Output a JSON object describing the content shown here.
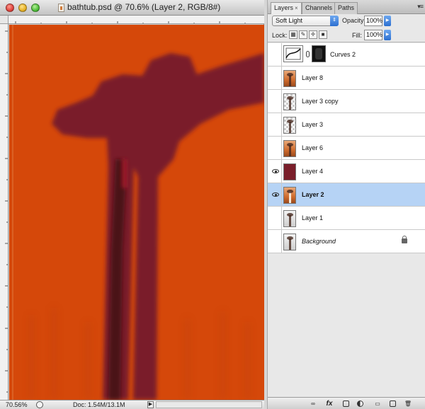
{
  "document": {
    "title": "bathtub.psd @ 70.6% (Layer 2, RGB/8#)",
    "zoom": "70.56%",
    "doc_size": "Doc: 1.54M/13.1M",
    "canvas_color": "#d5480a",
    "figure_color": "#7a1f2c"
  },
  "panel": {
    "tabs": [
      {
        "label": "Layers",
        "active": true,
        "closable": true
      },
      {
        "label": "Channels",
        "active": false
      },
      {
        "label": "Paths",
        "active": false
      }
    ],
    "close_glyph": "×",
    "blend_mode": "Soft Light",
    "opacity_label": "Opacity:",
    "opacity_value": "100%",
    "lock_label": "Lock:",
    "fill_label": "Fill:",
    "fill_value": "100%",
    "layers": [
      {
        "name": "Curves 2",
        "visible": false,
        "selected": false,
        "type": "adjustment"
      },
      {
        "name": "Layer 8",
        "visible": false,
        "selected": false,
        "thumb": "orange"
      },
      {
        "name": "Layer 3 copy",
        "visible": false,
        "selected": false,
        "thumb": "checker"
      },
      {
        "name": "Layer 3",
        "visible": false,
        "selected": false,
        "thumb": "checker"
      },
      {
        "name": "Layer 6",
        "visible": false,
        "selected": false,
        "thumb": "orange"
      },
      {
        "name": "Layer 4",
        "visible": true,
        "selected": false,
        "thumb": "maroon"
      },
      {
        "name": "Layer 2",
        "visible": true,
        "selected": true,
        "thumb": "orange"
      },
      {
        "name": "Layer 1",
        "visible": false,
        "selected": false,
        "thumb": "gray"
      },
      {
        "name": "Background",
        "visible": false,
        "selected": false,
        "thumb": "gray",
        "locked": true
      }
    ],
    "footer_icons": [
      "link-icon",
      "fx-icon",
      "mask-icon",
      "adjustment-icon",
      "group-icon",
      "new-layer-icon",
      "trash-icon"
    ],
    "footer_fx_label": "fx",
    "selected_color": "#b6d3f5"
  }
}
